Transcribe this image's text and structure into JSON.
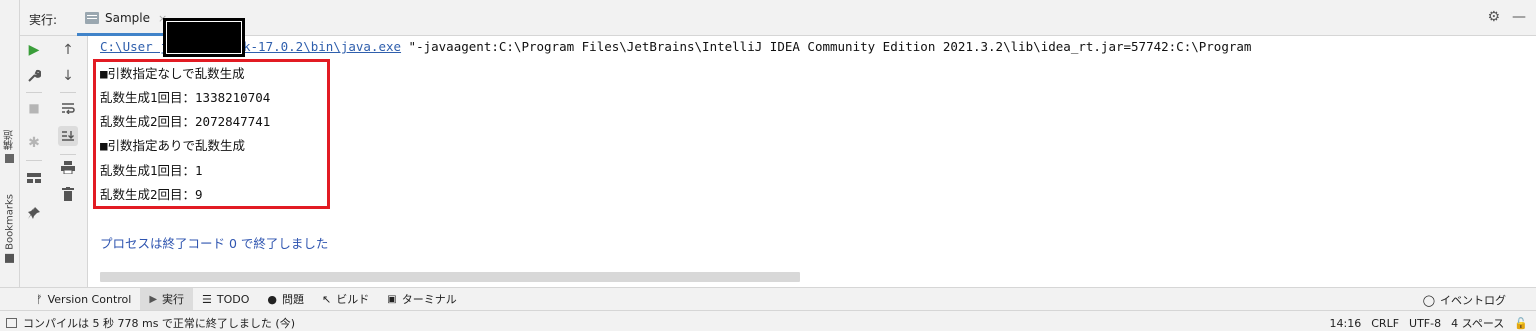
{
  "header": {
    "run_label": "実行:",
    "tab_label": "Sample",
    "tab_close": "×"
  },
  "left_stripe": {
    "structure_label": "構造",
    "bookmarks_label": "Bookmarks"
  },
  "toolbar": {
    "rerun": "▶",
    "up": "↑",
    "wrench": "🔧",
    "down": "↓",
    "stop": "■",
    "softwrap": "⤶",
    "bug": "✱",
    "scroll_end": "⇊",
    "layout": "▬",
    "print": "🖶",
    "pin": "📌",
    "trash": "🗑"
  },
  "console": {
    "cmd_link": "C:\\User        jdks\\openjdk-17.0.2\\bin\\java.exe",
    "cmd_rest": " \"-javaagent:C:\\Program Files\\JetBrains\\IntelliJ IDEA Community Edition 2021.3.2\\lib\\idea_rt.jar=57742:C:\\Program",
    "lines": [
      "■引数指定なしで乱数生成",
      "乱数生成1回目：1338210704",
      "乱数生成2回目：2072847741",
      "■引数指定ありで乱数生成",
      "乱数生成1回目：1",
      "乱数生成2回目：9"
    ],
    "process_line": "プロセスは終了コード 0 で終了しました"
  },
  "toolstrip": {
    "version_control": "Version Control",
    "run": "実行",
    "todo": "TODO",
    "problems": "問題",
    "build": "ビルド",
    "terminal": "ターミナル",
    "event_log": "イベントログ"
  },
  "statusbar": {
    "message": "コンパイルは 5 秒 778 ms で正常に終了しました (今)",
    "position": "14:16",
    "line_sep": "CRLF",
    "encoding": "UTF-8",
    "indent": "4 スペース"
  },
  "colors": {
    "highlight_box": "#e21b23",
    "link": "#2f5fad",
    "process_text": "#2f55b0",
    "run_green": "#3a9e3a"
  }
}
